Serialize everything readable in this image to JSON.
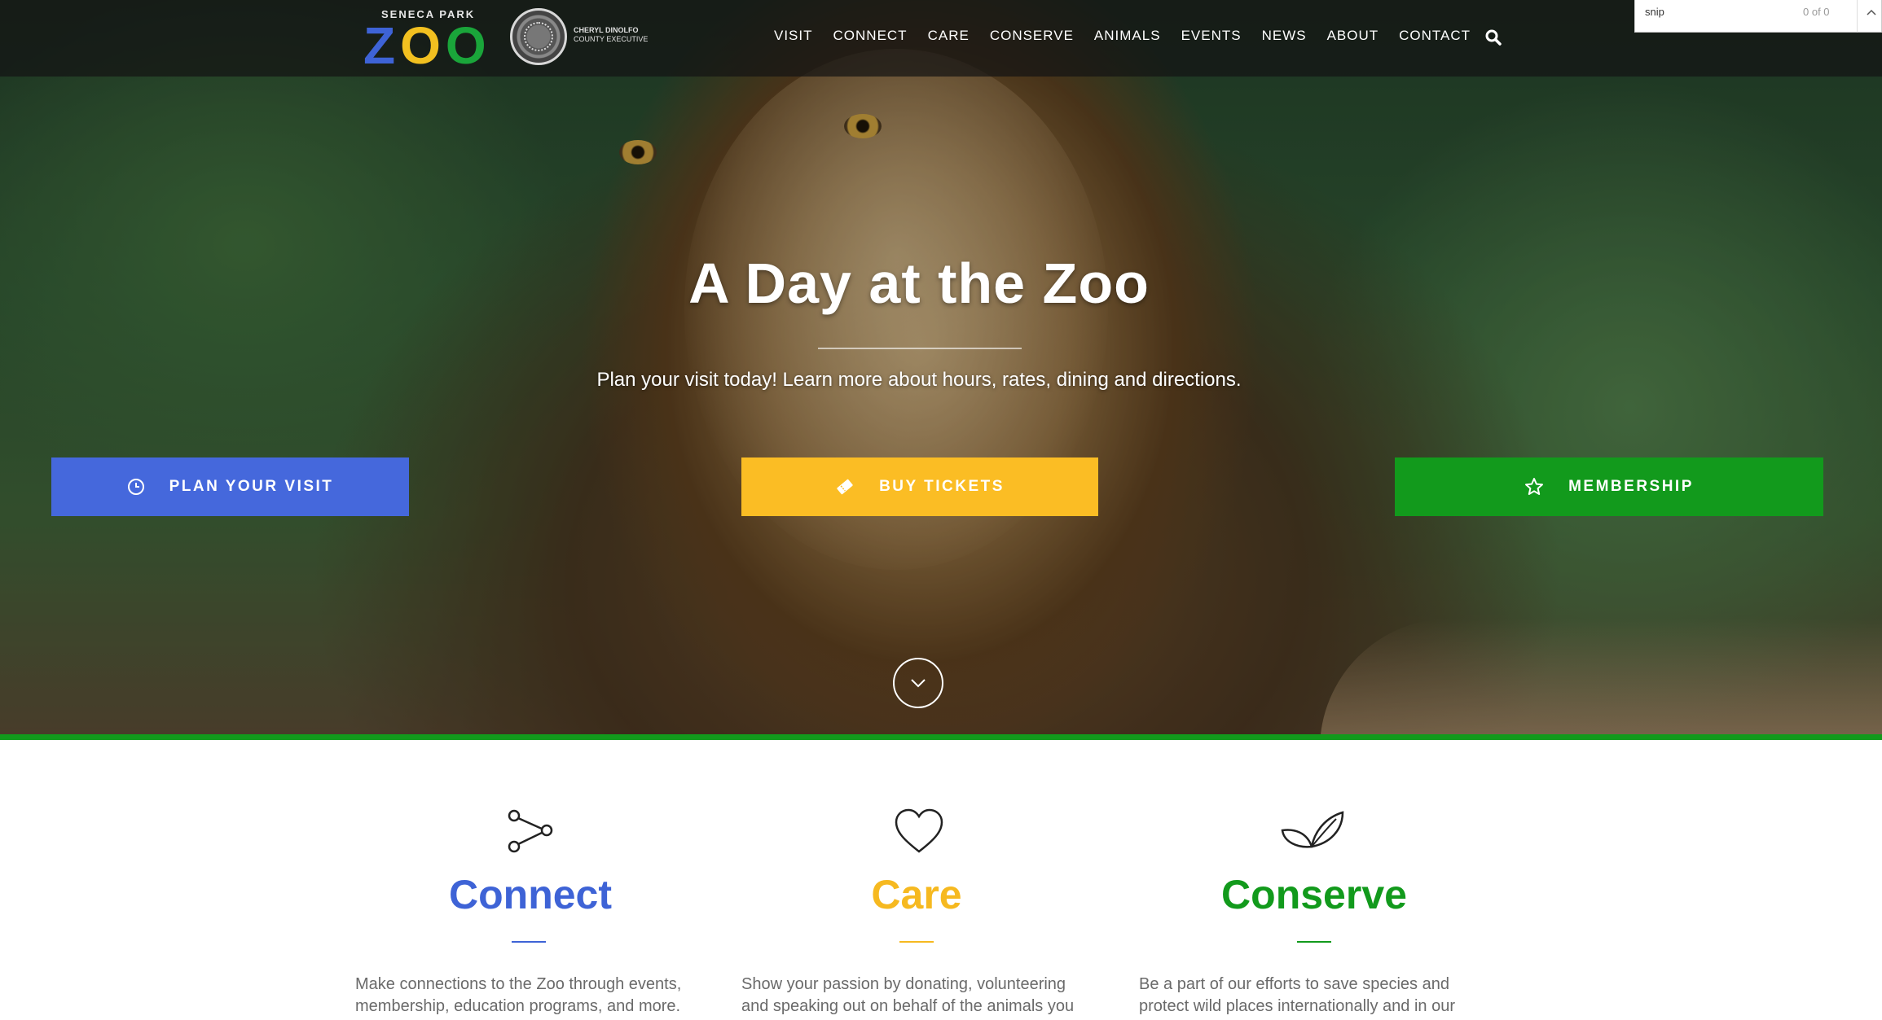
{
  "header": {
    "logo": {
      "small_text": "SENECA PARK",
      "main_letters": [
        "Z",
        "O",
        "O"
      ],
      "colors": [
        "#3e63d6",
        "#f2c020",
        "#1aa53a"
      ]
    },
    "seal": {
      "name": "CHERYL DINOLFO",
      "title": "COUNTY EXECUTIVE"
    },
    "nav": [
      "VISIT",
      "CONNECT",
      "CARE",
      "CONSERVE",
      "ANIMALS",
      "EVENTS",
      "NEWS",
      "ABOUT",
      "CONTACT"
    ],
    "search_icon": "search-icon"
  },
  "snip": {
    "query": "snip",
    "count": "0 of 0"
  },
  "hero": {
    "title": "A Day at the Zoo",
    "subtitle": "Plan your visit today! Learn more about hours, rates, dining and directions.",
    "buttons": [
      {
        "label": "PLAN YOUR VISIT",
        "icon": "clock-icon",
        "color": "#4568dc"
      },
      {
        "label": "BUY TICKETS",
        "icon": "ticket-icon",
        "color": "#fbbd24"
      },
      {
        "label": "MEMBERSHIP",
        "icon": "star-icon",
        "color": "#129a1c"
      }
    ],
    "scroll_icon": "chevron-down-icon"
  },
  "pillars": [
    {
      "title": "Connect",
      "icon": "share-icon",
      "color": "#3e63d6",
      "text": "Make connections to the Zoo through events, membership, education programs, and more."
    },
    {
      "title": "Care",
      "icon": "heart-icon",
      "color": "#f6b920",
      "text": "Show your passion by donating, volunteering and speaking out on behalf of the animals you love."
    },
    {
      "title": "Conserve",
      "icon": "leaves-icon",
      "color": "#129a1c",
      "text": "Be a part of our efforts to save species and protect wild places internationally and in our"
    }
  ]
}
